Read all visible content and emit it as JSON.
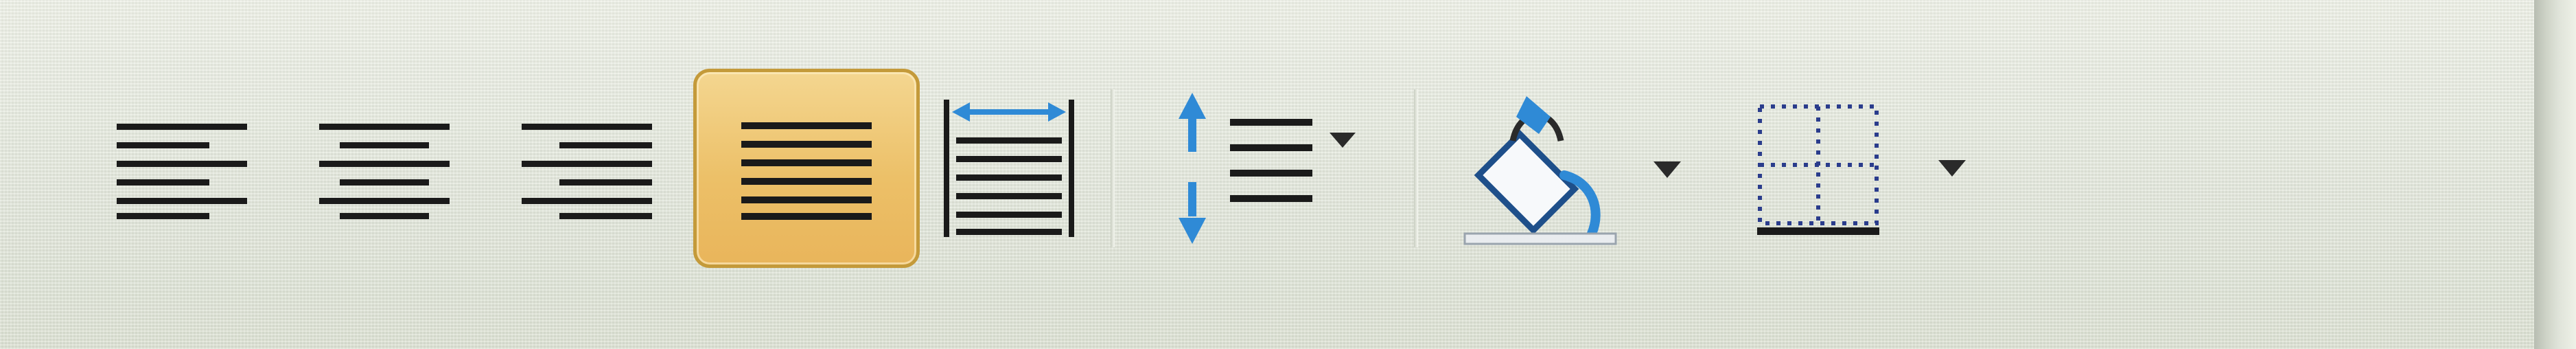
{
  "toolbar": {
    "tools": [
      {
        "name": "align-left",
        "icon": "align-left-icon",
        "active": false
      },
      {
        "name": "align-center",
        "icon": "align-center-icon",
        "active": false
      },
      {
        "name": "align-right",
        "icon": "align-right-icon",
        "active": false
      },
      {
        "name": "justify",
        "icon": "justify-icon",
        "active": true
      },
      {
        "name": "distributed",
        "icon": "distributed-icon",
        "active": false
      },
      {
        "name": "line-spacing",
        "icon": "line-spacing-icon",
        "has_dropdown": true
      },
      {
        "name": "shading",
        "icon": "paint-bucket-icon",
        "has_dropdown": true
      },
      {
        "name": "borders",
        "icon": "borders-icon",
        "has_dropdown": true
      }
    ]
  },
  "colors": {
    "background": "#e8ecdf",
    "active_fill": "#ecc068",
    "active_border": "#c49a3a",
    "icon_line": "#1a1a1a",
    "arrow_blue": "#2f8ad6"
  }
}
